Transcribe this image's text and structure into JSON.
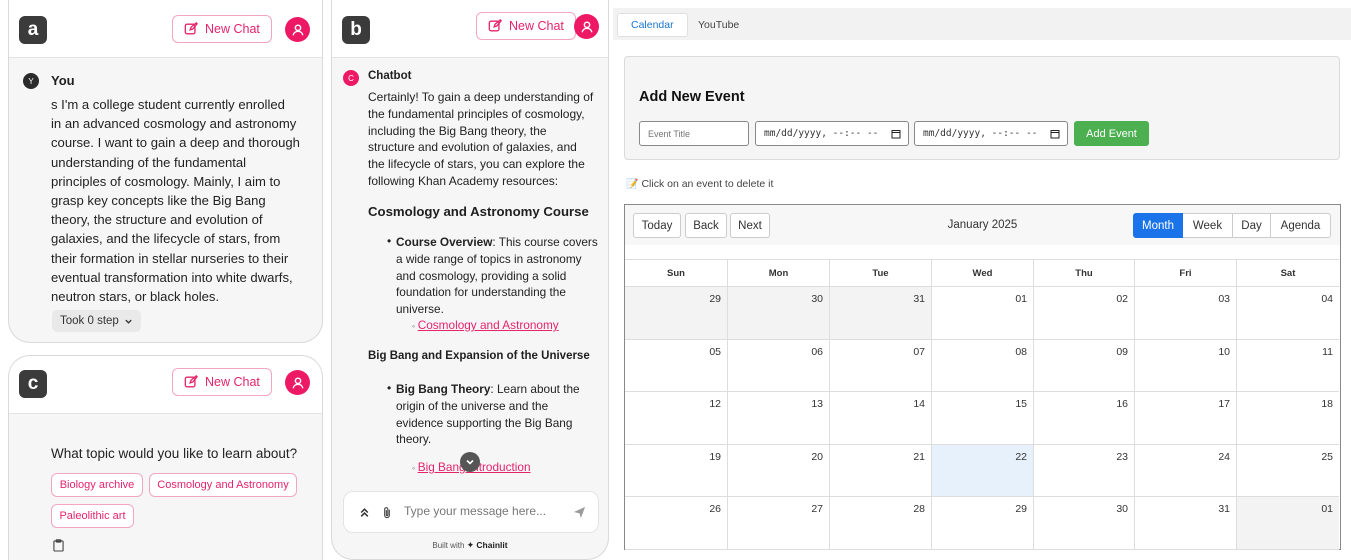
{
  "panel_a": {
    "tag": "a",
    "new_chat": "New Chat",
    "user_initial": "Y",
    "author": "You",
    "message_lines": [
      "s I'm a college student currently enrolled",
      "in an advanced cosmology and astronomy",
      "course. I want to gain a deep and thorough",
      "understanding of the fundamental",
      "principles of cosmology. Mainly, I aim to",
      "grasp key concepts like the Big Bang",
      "theory, the structure and evolution of",
      "galaxies, and the lifecycle of stars, from",
      "their formation in stellar nurseries to their",
      "eventual transformation into white dwarfs,",
      "neutron stars, or black holes."
    ],
    "took_step": "Took 0 step"
  },
  "panel_c": {
    "tag": "c",
    "new_chat": "New Chat",
    "question": "What topic would you like to learn about?",
    "chips": [
      "Biology archive",
      "Cosmology and Astronomy",
      "Paleolithic art"
    ]
  },
  "panel_b": {
    "tag": "b",
    "new_chat": "New Chat",
    "bot_initial": "C",
    "author": "Chatbot",
    "intro_lines": [
      "Certainly! To gain a deep understanding of",
      "the fundamental principles of cosmology,",
      "including the Big Bang theory, the",
      "structure and evolution of galaxies, and",
      "the lifecycle of stars, you can explore the",
      "following Khan Academy resources:"
    ],
    "heading_course": "Cosmology and Astronomy Course",
    "course_label": "Course Overview",
    "course_lines": [
      ": This course covers",
      "a wide range of topics in astronomy",
      "and cosmology, providing a solid",
      "foundation for understanding the",
      "universe."
    ],
    "course_link": "Cosmology and Astronomy",
    "heading_bigbang": "Big Bang and Expansion of the Universe",
    "bigbang_label": "Big Bang Theory",
    "bigbang_lines": [
      ": Learn about the",
      "origin of the universe and the",
      "evidence supporting the Big Bang",
      "theory."
    ],
    "bigbang_link": "Big Bang Introduction",
    "composer_placeholder": "Type your message here...",
    "built_with": "Built with",
    "brand": "Chainlit"
  },
  "calendar_app": {
    "tabs": [
      "Calendar",
      "YouTube"
    ],
    "form_title": "Add New Event",
    "title_placeholder": "Event Title",
    "start_value": "mm/dd/yyyy, --:-- --",
    "end_value": "mm/dd/yyyy, --:-- --",
    "add_button": "Add Event",
    "hint": "Click on an event to delete it",
    "nav_buttons": [
      "Today",
      "Back",
      "Next"
    ],
    "month_label": "January 2025",
    "view_buttons": [
      "Month",
      "Week",
      "Day",
      "Agenda"
    ],
    "active_view": "Month",
    "weekdays": [
      "Sun",
      "Mon",
      "Tue",
      "Wed",
      "Thu",
      "Fri",
      "Sat"
    ],
    "weeks": [
      [
        "29",
        "30",
        "31",
        "01",
        "02",
        "03",
        "04"
      ],
      [
        "05",
        "06",
        "07",
        "08",
        "09",
        "10",
        "11"
      ],
      [
        "12",
        "13",
        "14",
        "15",
        "16",
        "17",
        "18"
      ],
      [
        "19",
        "20",
        "21",
        "22",
        "23",
        "24",
        "25"
      ],
      [
        "26",
        "27",
        "28",
        "29",
        "30",
        "31",
        "01"
      ]
    ],
    "today": "22",
    "colors": {
      "accent": "#1a73e8",
      "add_button": "#4caf50",
      "today_bg": "#e6f1fc",
      "chat_brand": "#ee1965"
    }
  }
}
